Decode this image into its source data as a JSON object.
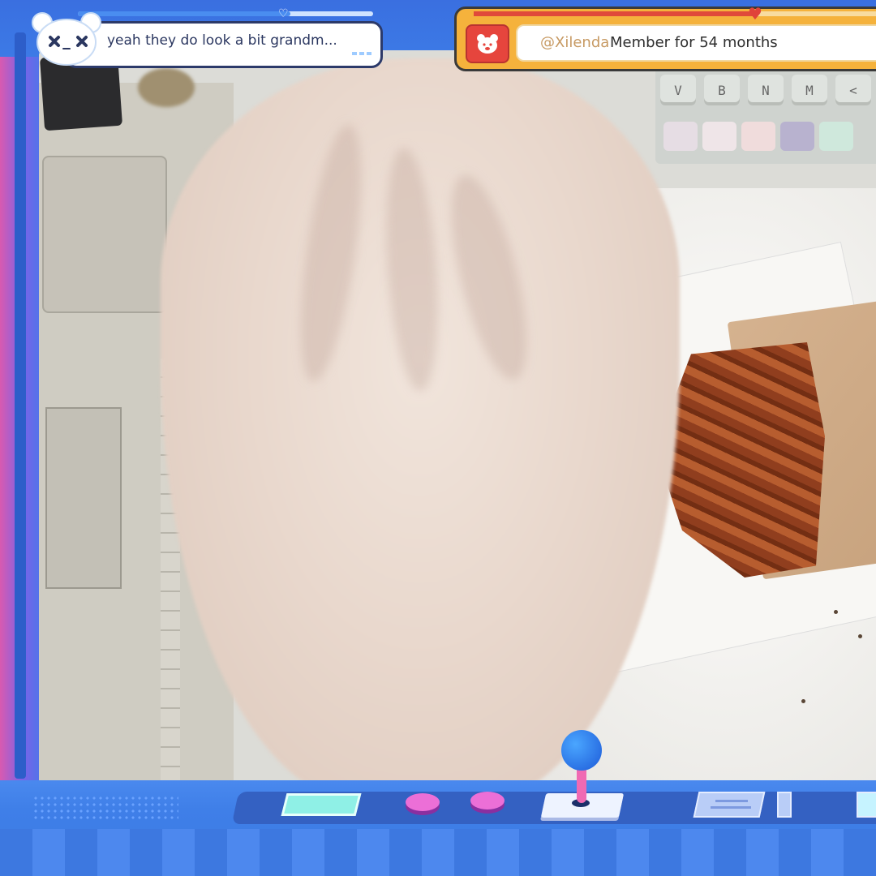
{
  "chat": {
    "avatar_icon": "bear-x-eyes-icon",
    "message": "yeah they do look a bit grandm...",
    "progress": 0.72
  },
  "member_alert": {
    "badge_icon": "red-bear-badge-icon",
    "username": "@Xilenda",
    "text": "Member for 54 months",
    "progress": 0.7
  },
  "keyboard": {
    "keys": [
      "V",
      "B",
      "N",
      "M",
      "<"
    ]
  },
  "colors": {
    "frame_blue": "#3a7be8",
    "chat_border": "#2c3a6a",
    "member_orange": "#f5b23c",
    "member_red": "#e6453d",
    "joystick_blue": "#2f7ef0",
    "button_pink": "#ec6fd7"
  }
}
